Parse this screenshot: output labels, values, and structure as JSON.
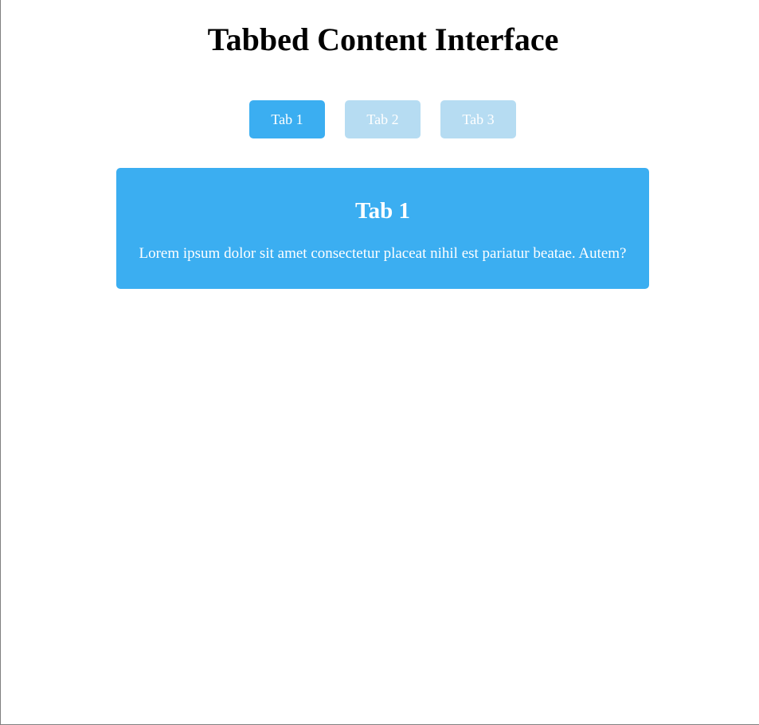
{
  "page": {
    "title": "Tabbed Content Interface"
  },
  "tabs": [
    {
      "label": "Tab 1",
      "active": true
    },
    {
      "label": "Tab 2",
      "active": false
    },
    {
      "label": "Tab 3",
      "active": false
    }
  ],
  "panel": {
    "title": "Tab 1",
    "text": "Lorem ipsum dolor sit amet consectetur placeat nihil est pariatur beatae. Autem?"
  },
  "colors": {
    "active_tab": "#3baef1",
    "inactive_tab": "#b6dcf2",
    "panel_background": "#3baef1",
    "tab_text": "#ffffff"
  }
}
